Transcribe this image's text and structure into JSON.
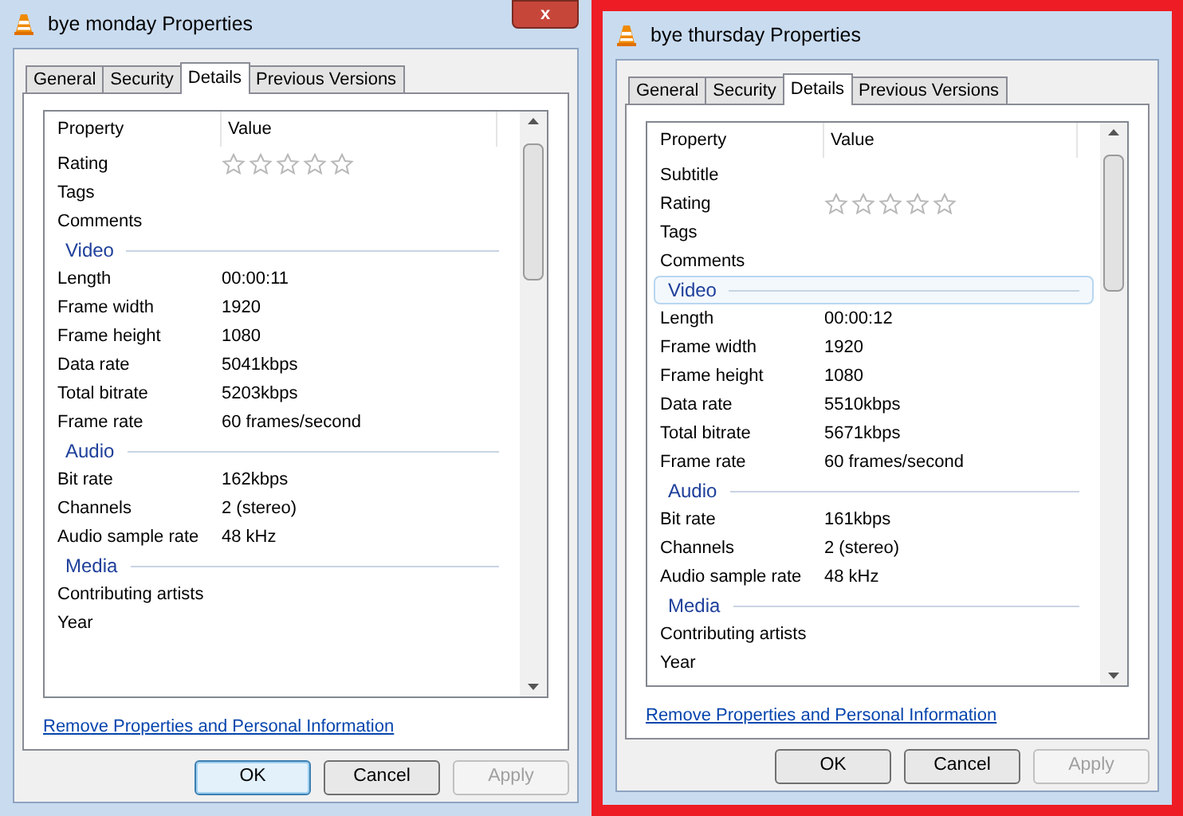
{
  "dialogs": [
    {
      "title": "bye monday Properties",
      "highlighted": false,
      "close_label": "x",
      "tabs": [
        {
          "label": "General",
          "selected": false
        },
        {
          "label": "Security",
          "selected": false
        },
        {
          "label": "Details",
          "selected": true
        },
        {
          "label": "Previous Versions",
          "selected": false
        }
      ],
      "columns": [
        "Property",
        "Value"
      ],
      "rows": [
        {
          "kind": "stars",
          "label": "Rating",
          "stars": 0
        },
        {
          "kind": "prop",
          "label": "Tags"
        },
        {
          "kind": "prop",
          "label": "Comments"
        },
        {
          "kind": "group",
          "label": "Video",
          "selected": false
        },
        {
          "kind": "prop",
          "label": "Length",
          "value": "00:00:11"
        },
        {
          "kind": "prop",
          "label": "Frame width",
          "value": "1920"
        },
        {
          "kind": "prop",
          "label": "Frame height",
          "value": "1080"
        },
        {
          "kind": "prop",
          "label": "Data rate",
          "value": "5041kbps"
        },
        {
          "kind": "prop",
          "label": "Total bitrate",
          "value": "5203kbps"
        },
        {
          "kind": "prop",
          "label": "Frame rate",
          "value": "60 frames/second"
        },
        {
          "kind": "group",
          "label": "Audio",
          "selected": false
        },
        {
          "kind": "prop",
          "label": "Bit rate",
          "value": "162kbps"
        },
        {
          "kind": "prop",
          "label": "Channels",
          "value": "2 (stereo)"
        },
        {
          "kind": "prop",
          "label": "Audio sample rate",
          "value": "48 kHz"
        },
        {
          "kind": "group",
          "label": "Media",
          "selected": false
        },
        {
          "kind": "prop",
          "label": "Contributing artists"
        },
        {
          "kind": "prop",
          "label": "Year"
        }
      ],
      "link": "Remove Properties and Personal Information",
      "buttons": [
        {
          "label": "OK",
          "default": true,
          "disabled": false
        },
        {
          "label": "Cancel",
          "default": false,
          "disabled": false
        },
        {
          "label": "Apply",
          "default": false,
          "disabled": true
        }
      ]
    },
    {
      "title": "bye thursday Properties",
      "highlighted": true,
      "tabs": [
        {
          "label": "General",
          "selected": false
        },
        {
          "label": "Security",
          "selected": false
        },
        {
          "label": "Details",
          "selected": true
        },
        {
          "label": "Previous Versions",
          "selected": false
        }
      ],
      "columns": [
        "Property",
        "Value"
      ],
      "rows": [
        {
          "kind": "prop",
          "label": "Subtitle"
        },
        {
          "kind": "stars",
          "label": "Rating",
          "stars": 0
        },
        {
          "kind": "prop",
          "label": "Tags"
        },
        {
          "kind": "prop",
          "label": "Comments"
        },
        {
          "kind": "group",
          "label": "Video",
          "selected": true
        },
        {
          "kind": "prop",
          "label": "Length",
          "value": "00:00:12"
        },
        {
          "kind": "prop",
          "label": "Frame width",
          "value": "1920"
        },
        {
          "kind": "prop",
          "label": "Frame height",
          "value": "1080"
        },
        {
          "kind": "prop",
          "label": "Data rate",
          "value": "5510kbps"
        },
        {
          "kind": "prop",
          "label": "Total bitrate",
          "value": "5671kbps"
        },
        {
          "kind": "prop",
          "label": "Frame rate",
          "value": "60 frames/second"
        },
        {
          "kind": "group",
          "label": "Audio",
          "selected": false
        },
        {
          "kind": "prop",
          "label": "Bit rate",
          "value": "161kbps"
        },
        {
          "kind": "prop",
          "label": "Channels",
          "value": "2 (stereo)"
        },
        {
          "kind": "prop",
          "label": "Audio sample rate",
          "value": "48 kHz"
        },
        {
          "kind": "group",
          "label": "Media",
          "selected": false
        },
        {
          "kind": "prop",
          "label": "Contributing artists"
        },
        {
          "kind": "prop",
          "label": "Year"
        }
      ],
      "link": "Remove Properties and Personal Information",
      "buttons": [
        {
          "label": "OK",
          "default": false,
          "disabled": false
        },
        {
          "label": "Cancel",
          "default": false,
          "disabled": false
        },
        {
          "label": "Apply",
          "default": false,
          "disabled": true
        }
      ]
    }
  ]
}
